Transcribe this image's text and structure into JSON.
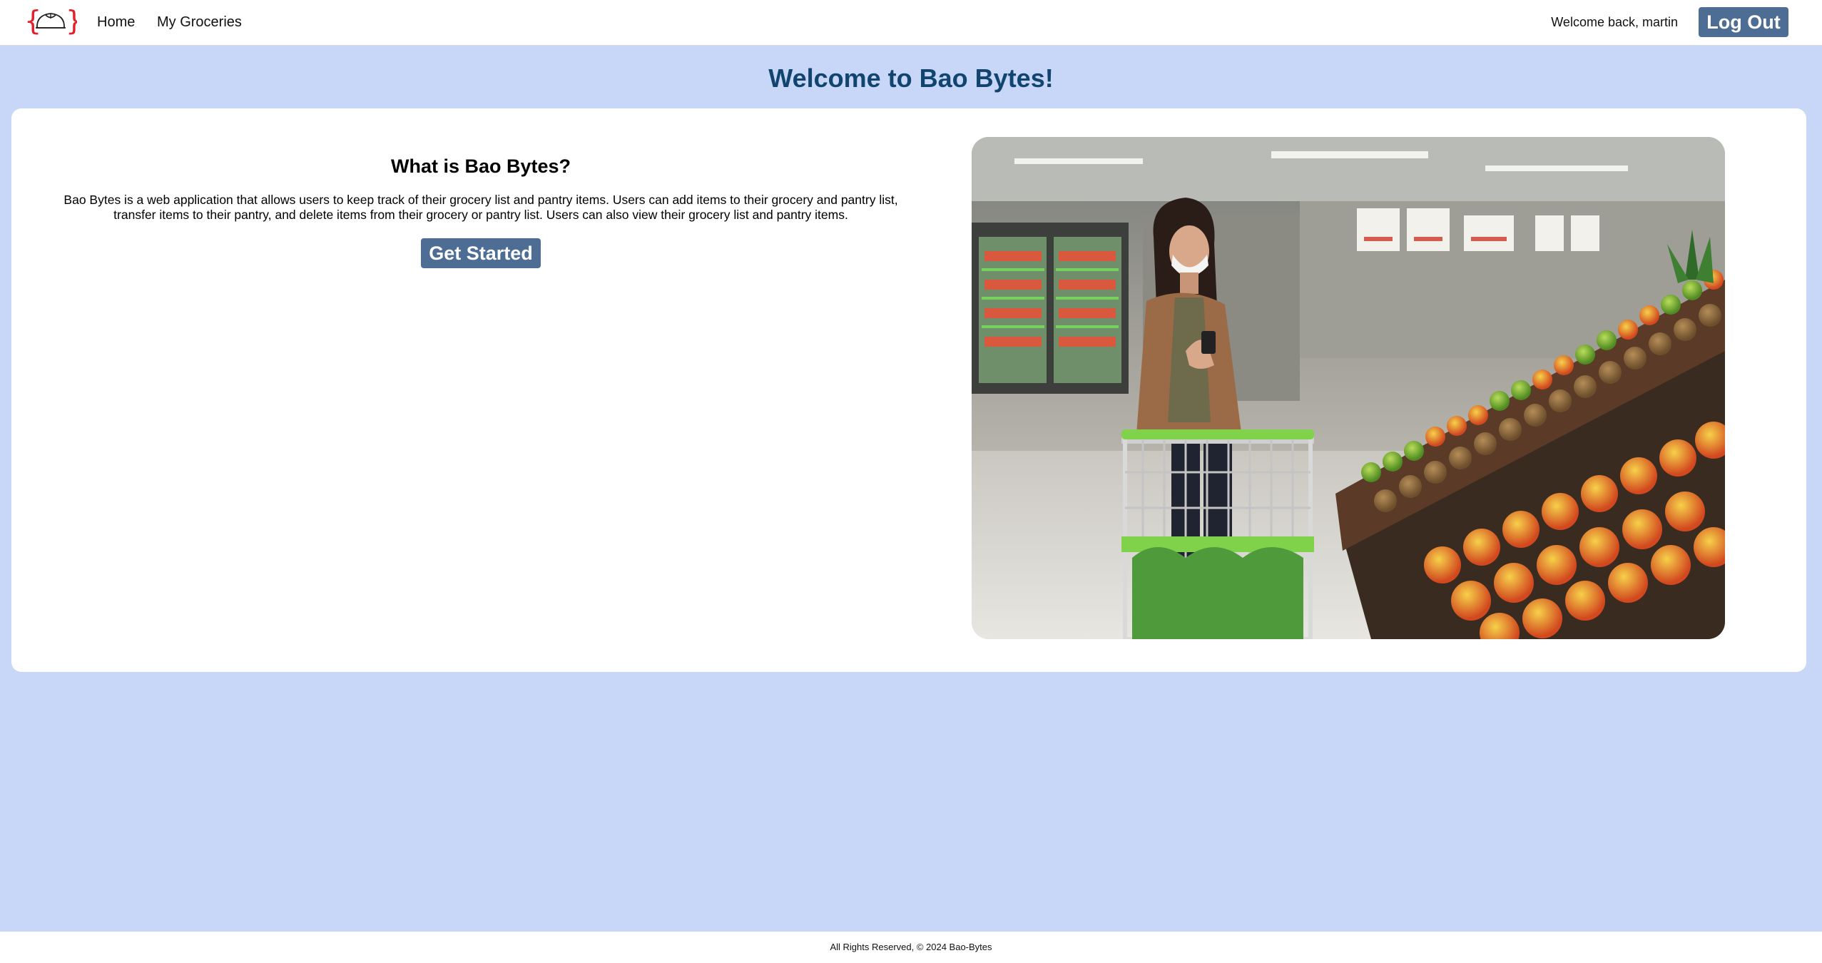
{
  "colors": {
    "page_background": "#c8d7f7",
    "accent_button": "#4d6d95",
    "title": "#124470",
    "logo_braces": "#e0202a"
  },
  "nav": {
    "logo_icon": "bao-bun-logo-icon",
    "links": [
      "Home",
      "My Groceries"
    ],
    "welcome_text": "Welcome back, martin",
    "logout_label": "Log Out"
  },
  "main": {
    "title": "Welcome to Bao Bytes!",
    "about_heading": "What is Bao Bytes?",
    "about_text": "Bao Bytes is a web application that allows users to keep track of their grocery list and pantry items. Users can add items to their grocery and pantry list, transfer items to their pantry, and delete items from their grocery or pantry list. Users can also view their grocery list and pantry items.",
    "cta_label": "Get Started"
  },
  "footer": {
    "text": "All Rights Reserved, © 2024 Bao-Bytes"
  }
}
